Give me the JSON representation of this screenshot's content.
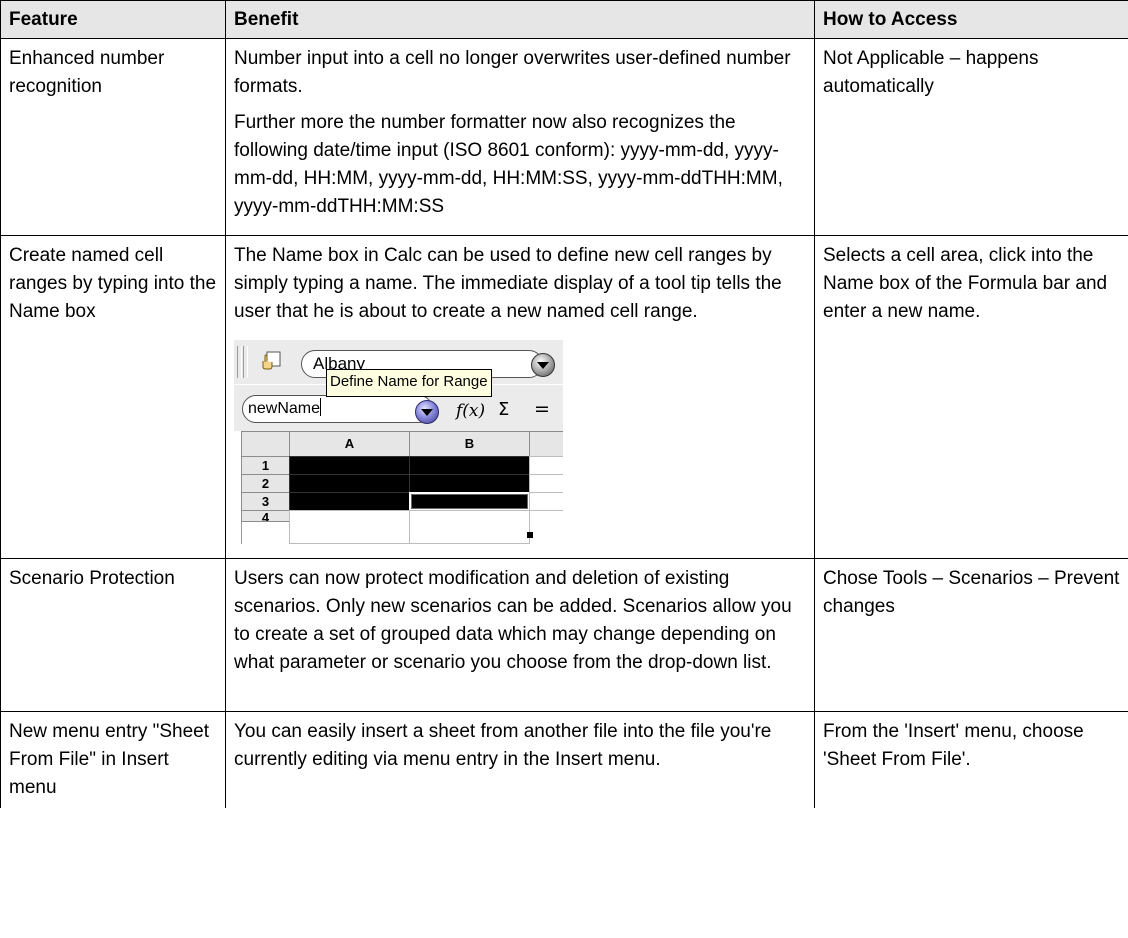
{
  "table": {
    "headers": {
      "feature": "Feature",
      "benefit": "Benefit",
      "access": "How to Access"
    },
    "rows": [
      {
        "feature": "Enhanced number recognition",
        "benefit_p1": "Number input into a cell no longer overwrites user-defined number formats.",
        "benefit_p2": "Further more the number formatter now also recognizes the following date/time input (ISO 8601 conform): yyyy-mm-dd, yyyy-mm-dd, HH:MM, yyyy-mm-dd, HH:MM:SS, yyyy-mm-ddTHH:MM, yyyy-mm-ddTHH:MM:SS",
        "access": "Not Applicable – happens automatically"
      },
      {
        "feature": "Create named cell ranges by typing into the Name box",
        "benefit_p1": "The Name box in Calc can be used to define new cell ranges by simply typing a name. The immediate display of a tool tip tells the user that he is about to create a new named cell range.",
        "access": "Selects a cell area, click into the Name box of the Formula bar and enter a new name."
      },
      {
        "feature": "Scenario Protection",
        "benefit_p1": "Users can now protect modification and deletion of existing scenarios. Only new scenarios can be added. Scenarios allow you to create a set of grouped data which may change depending on what parameter or scenario you choose from the drop-down list.",
        "access": "Chose Tools – Scenarios – Prevent changes"
      },
      {
        "feature": "New menu entry \"Sheet From File\" in Insert menu",
        "benefit_p1": "You can easily insert a sheet from another file into the file you're currently editing via menu entry in the Insert menu.",
        "access": "From the 'Insert' menu, choose 'Sheet From File'."
      }
    ]
  },
  "screenshot": {
    "font_name": "Albany",
    "tooltip": "Define Name for Range",
    "name_box_value": "newName",
    "fx_label": "f(x)",
    "sigma_label": "Σ",
    "equals_label": "=",
    "columns": [
      "A",
      "B"
    ],
    "rows": [
      "1",
      "2",
      "3",
      "4"
    ],
    "icons": {
      "navigator": "navigator-icon",
      "font_dropdown": "chevron-down-icon",
      "name_dropdown": "chevron-down-icon",
      "function_wizard": "function-wizard-icon",
      "sum": "sum-icon",
      "formula": "equals-icon"
    }
  }
}
